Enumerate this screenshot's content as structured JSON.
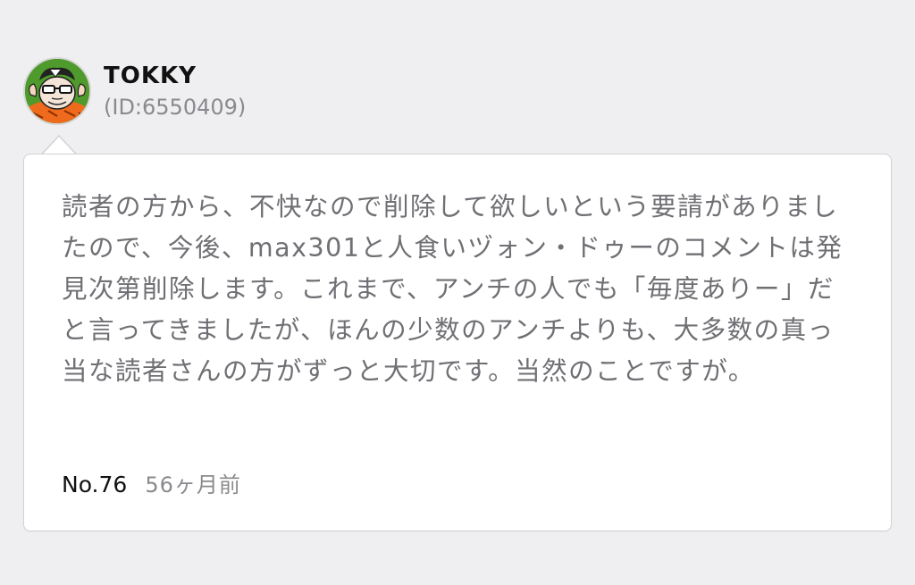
{
  "user": {
    "name": "TOKKY",
    "id_label": "(ID:6550409)"
  },
  "comment": {
    "text": "読者の方から、不快なので削除して欲しいという要請がありましたので、今後、max301と人食いヅォン・ドゥーのコメントは発見次第削除します。これまで、アンチの人でも「毎度ありー」だと言ってきましたが、ほんの少数のアンチよりも、大多数の真っ当な読者さんの方がずっと大切です。当然のことですが。",
    "number": "No.76",
    "time": "56ヶ月前"
  },
  "colors": {
    "background": "#efeff1",
    "bubble": "#ffffff",
    "body_text": "#6f6f74",
    "muted_text": "#8a8a8e"
  },
  "icons": {
    "avatar": "cartoon-portrait-avatar"
  }
}
